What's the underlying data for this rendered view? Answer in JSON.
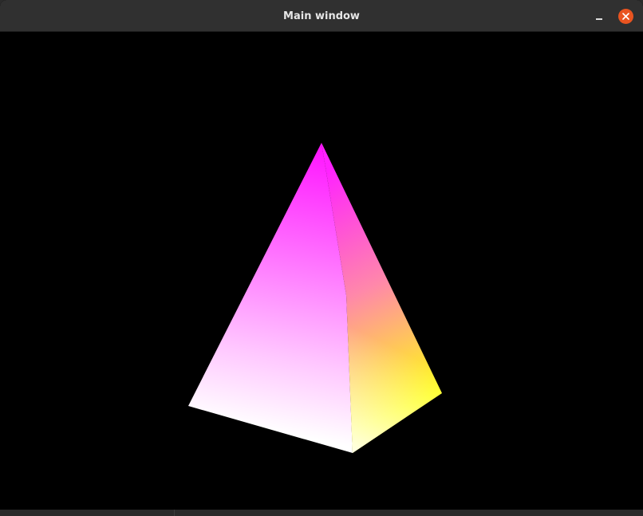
{
  "window": {
    "title": "Main window"
  },
  "titlebar_controls": [
    {
      "name": "minimize",
      "icon": "minimize-icon"
    },
    {
      "name": "close",
      "icon": "close-icon",
      "color": "#e95420"
    }
  ],
  "scene": {
    "background": "#000000",
    "object": "pyramid",
    "vertex_colors": [
      "#ff00ff",
      "#ffffff",
      "#ffff00",
      "#ffffff"
    ]
  }
}
